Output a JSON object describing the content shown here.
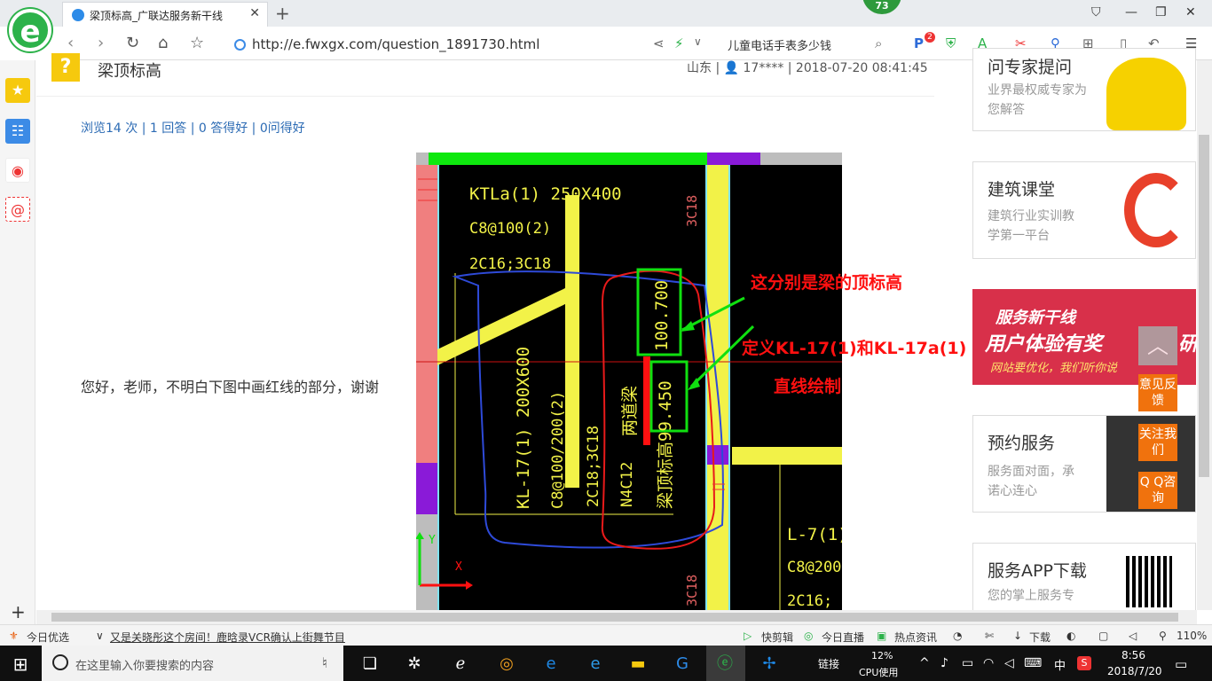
{
  "browser": {
    "tab_title": "梁顶标高_广联达服务新干线",
    "badge_count": "73",
    "url": "http://e.fwxgx.com/question_1891730.html",
    "search_text": "儿童电话手表多少钱",
    "ext_badge": "2"
  },
  "question": {
    "title": "梁顶标高",
    "meta": "山东 | 👤 17**** | 2018-07-20 08:41:45",
    "stats": "浏览14 次 | 1 回答 | 0 答得好 | 0问得好",
    "text": "您好，老师，不明白下图中画红线的部分，谢谢"
  },
  "cad": {
    "t1": "KTLa(1) 250X400",
    "t2": "C8@100(2)",
    "t3": "2C16;3C18",
    "v_3c18_top": "3C18",
    "v_3c18_bot": "3C18",
    "v_size": "KL-17(1) 200X600",
    "v_stir": "C8@100/200(2)",
    "v_bars": "2C18;3C18",
    "v_side": "N4C12",
    "v_liangdao": "两道梁",
    "v_top1": "100.700",
    "v_top2": "梁顶标高99.450",
    "l7_1": "L-7(1)",
    "l7_2": "C8@200",
    "l7_3": "2C16;",
    "axis_y": "Y",
    "axis_x": "X",
    "note1": "这分别是梁的顶标高",
    "note2": "定义KL-17(1)和KL-17a(1)",
    "note3": "直线绘制"
  },
  "right": {
    "card1_title": "问专家提问",
    "card1_sub": "业界最权威专家为您解答",
    "card2_title": "建筑课堂",
    "card2_sub1": "建筑行业实训教",
    "card2_sub2": "学第一平台",
    "banner_1": "服务新干线",
    "banner_2": "用户体验有奖",
    "banner_2b": "研",
    "banner_3": "网站要优化，我们听你说",
    "card3_title": "预约服务",
    "card3_sub1": "服务面对面，承",
    "card3_sub2": "诺心连心",
    "card4_title": "服务APP下载",
    "card4_sub": "您的掌上服务专",
    "feedback": "意见反馈",
    "follow": "关注我们",
    "qq": "Q Q咨询"
  },
  "status": {
    "today": "今日优选",
    "news": "又是关晓彤这个房间！鹿晗录VCR确认上街舞节目",
    "kuaijian": "快剪辑",
    "live": "今日直播",
    "hot": "热点资讯",
    "download": "下载",
    "zoom": "110%"
  },
  "taskbar": {
    "search_placeholder": "在这里输入你要搜索的内容",
    "link": "链接",
    "cpu": "12%",
    "cpu_label": "CPU使用",
    "ime": "中",
    "time": "8:56",
    "date": "2018/7/20"
  }
}
